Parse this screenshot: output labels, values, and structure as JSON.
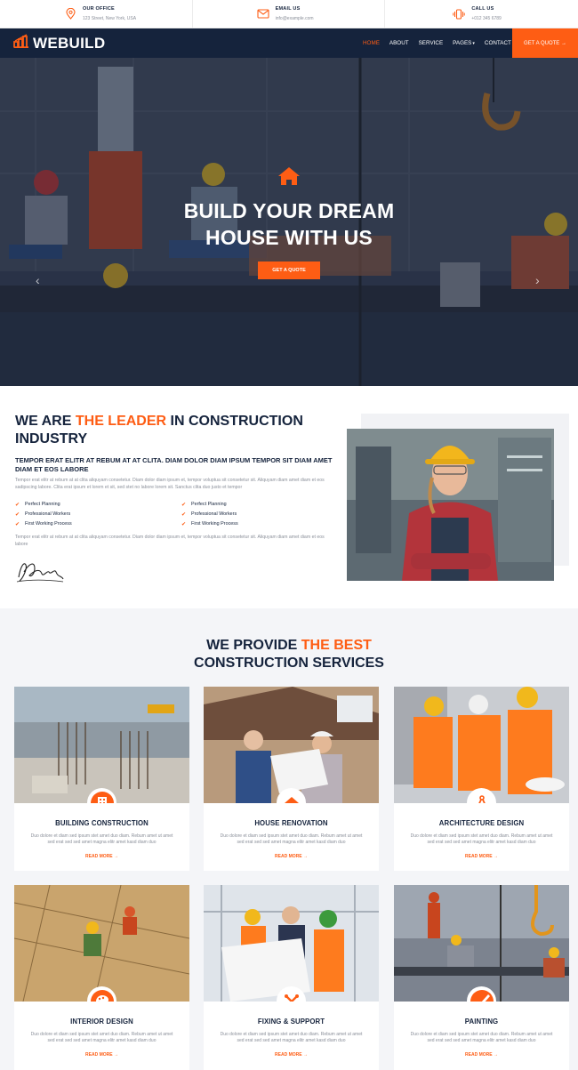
{
  "topbar": {
    "office": {
      "label": "OUR OFFICE",
      "value": "123 Street, New York, USA",
      "icon": "map-marker-icon"
    },
    "email": {
      "label": "EMAIL US",
      "value": "info@example.com",
      "icon": "envelope-icon"
    },
    "call": {
      "label": "CALL US",
      "value": "+012 345 6789",
      "icon": "phone-vibrate-icon"
    }
  },
  "brand": {
    "name": "WEBUILD",
    "accent": "#fe5d14",
    "dark": "#15233c"
  },
  "nav": {
    "items": [
      "HOME",
      "ABOUT",
      "SERVICE",
      "PAGES",
      "CONTACT"
    ],
    "active": "HOME",
    "quote_button": "GET A QUOTE →"
  },
  "hero": {
    "title_line1": "BUILD YOUR DREAM",
    "title_line2": "HOUSE WITH US",
    "button": "GET A QUOTE",
    "prev_arrow": "‹",
    "next_arrow": "›"
  },
  "about": {
    "title_pre": "WE ARE ",
    "title_highlight": "THE LEADER",
    "title_post": " IN CONSTRUCTION INDUSTRY",
    "subtitle": "TEMPOR ERAT ELITR AT REBUM AT AT CLITA. DIAM DOLOR DIAM IPSUM TEMPOR SIT DIAM AMET DIAM ET EOS LABORE",
    "para1": "Tempor erat elitr at rebum at at clita aliquyam consetetur. Diam dolor diam ipsum et, tempor voluptua sit consetetur sit. Aliquyam diam amet diam et eos sadipscing labore. Clita erat ipsum et lorem et sit, sed stet no labore lorem sit. Sanctus clita duo justo et tempor",
    "checks": [
      "Perfect Planning",
      "Perfect Planning",
      "Professional Workers",
      "Professional Workers",
      "First Working Process",
      "First Working Process"
    ],
    "para2": "Tempor erat elitr at rebum at at clita aliquyam consetetur. Diam dolor diam ipsum et, tempor voluptua sit consetetur sit. Aliquyam diam amet diam et eos labore"
  },
  "services": {
    "title_pre": "WE PROVIDE ",
    "title_highlight": "THE BEST",
    "title_line2": "CONSTRUCTION SERVICES",
    "cards": [
      {
        "name": "BUILDING CONSTRUCTION",
        "desc": "Duo dolore et diam sed ipsum stet amet duo diam. Rebum amet ut amet sed erat sed sed amet magna elitr amet kasd diam duo",
        "link": "READ MORE →",
        "icon": "building-icon"
      },
      {
        "name": "HOUSE RENOVATION",
        "desc": "Duo dolore et diam sed ipsum stet amet duo diam. Rebum amet ut amet sed erat sed sed amet magna elitr amet kasd diam duo",
        "link": "READ MORE →",
        "icon": "home-icon"
      },
      {
        "name": "ARCHITECTURE DESIGN",
        "desc": "Duo dolore et diam sed ipsum stet amet duo diam. Rebum amet ut amet sed erat sed sed amet magna elitr amet kasd diam duo",
        "link": "READ MORE →",
        "icon": "drafting-compass-icon"
      },
      {
        "name": "INTERIOR DESIGN",
        "desc": "Duo dolore et diam sed ipsum stet amet duo diam. Rebum amet ut amet sed erat sed sed amet magna elitr amet kasd diam duo",
        "link": "READ MORE →",
        "icon": "palette-icon"
      },
      {
        "name": "FIXING & SUPPORT",
        "desc": "Duo dolore et diam sed ipsum stet amet duo diam. Rebum amet ut amet sed erat sed sed amet magna elitr amet kasd diam duo",
        "link": "READ MORE →",
        "icon": "tools-icon"
      },
      {
        "name": "PAINTING",
        "desc": "Duo dolore et diam sed ipsum stet amet duo diam. Rebum amet ut amet sed erat sed sed amet magna elitr amet kasd diam duo",
        "link": "READ MORE →",
        "icon": "paint-brush-icon"
      }
    ]
  }
}
